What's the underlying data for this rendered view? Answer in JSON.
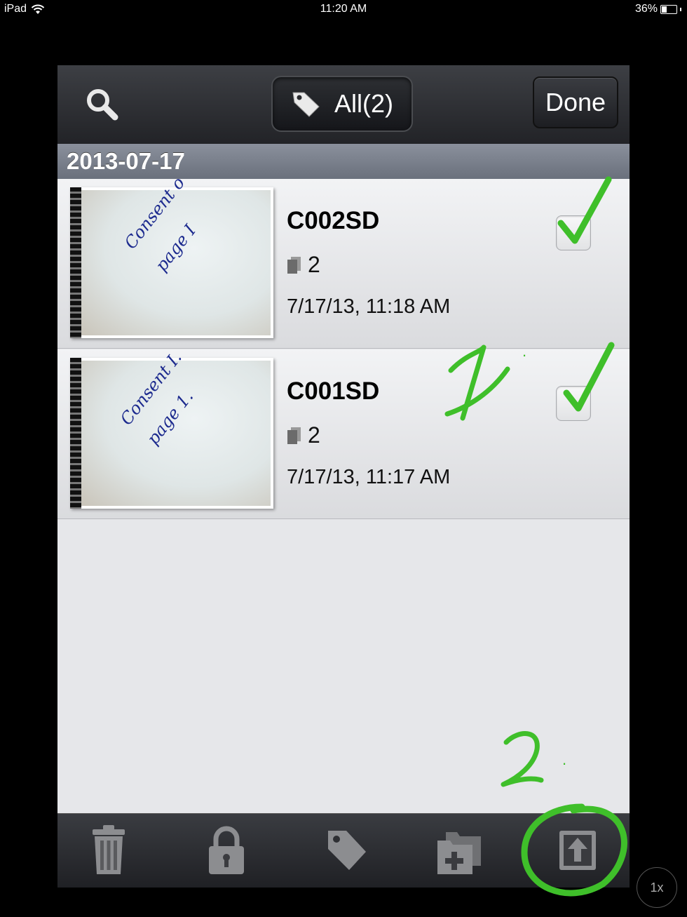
{
  "status_bar": {
    "device": "iPad",
    "time": "11:20 AM",
    "battery": "36%"
  },
  "toolbar": {
    "search_icon": "magnifier-icon",
    "filter_label": "All(2)",
    "filter_icon": "tag-icon",
    "done_label": "Done"
  },
  "section": {
    "date": "2013-07-17"
  },
  "documents": [
    {
      "name": "C002SD",
      "pages": "2",
      "date": "7/17/13, 11:18 AM",
      "selected": true,
      "thumb_note_line1": "Consent o",
      "thumb_note_line2": "page I"
    },
    {
      "name": "C001SD",
      "pages": "2",
      "date": "7/17/13, 11:17 AM",
      "selected": true,
      "thumb_note_line1": "Consent I.",
      "thumb_note_line2": "page 1."
    }
  ],
  "bottom_toolbar": {
    "icons": [
      "trash-icon",
      "lock-icon",
      "tag-icon",
      "new-folder-icon",
      "export-icon"
    ]
  },
  "annotations": {
    "step1": "1.",
    "step2": "2.",
    "color": "#3fbf2a"
  },
  "playback_speed": "1x"
}
